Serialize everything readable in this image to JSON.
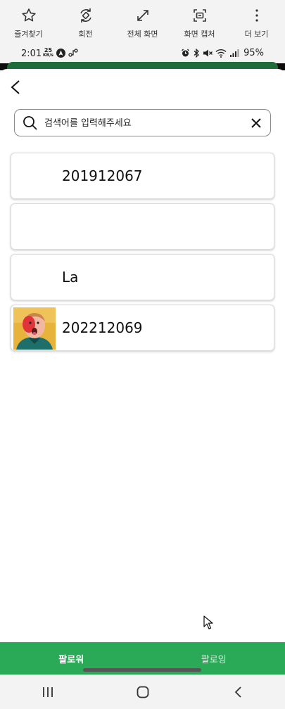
{
  "toolbar": {
    "items": [
      {
        "label": "즐겨찾기",
        "icon": "star-icon"
      },
      {
        "label": "회전",
        "icon": "rotate-icon"
      },
      {
        "label": "전체 화면",
        "icon": "fullscreen-icon"
      },
      {
        "label": "화면 캡처",
        "icon": "screen-capture-icon"
      },
      {
        "label": "더 보기",
        "icon": "more-vertical-icon"
      }
    ]
  },
  "status": {
    "time": "2:01",
    "speed_value": "25",
    "speed_unit": "KB/s",
    "battery": "95%"
  },
  "search": {
    "placeholder": "검색어를 입력해주세요",
    "value": ""
  },
  "followers": [
    {
      "name": "201912067",
      "has_avatar": false
    },
    {
      "name": "",
      "has_avatar": false
    },
    {
      "name": "La",
      "has_avatar": false
    },
    {
      "name": "202212069",
      "has_avatar": true
    }
  ],
  "tabs": {
    "followers_label": "팔로워",
    "following_label": "팔로잉",
    "active": "followers"
  },
  "colors": {
    "accent_green": "#2aaa57",
    "dark_green": "#1f6b3a"
  }
}
